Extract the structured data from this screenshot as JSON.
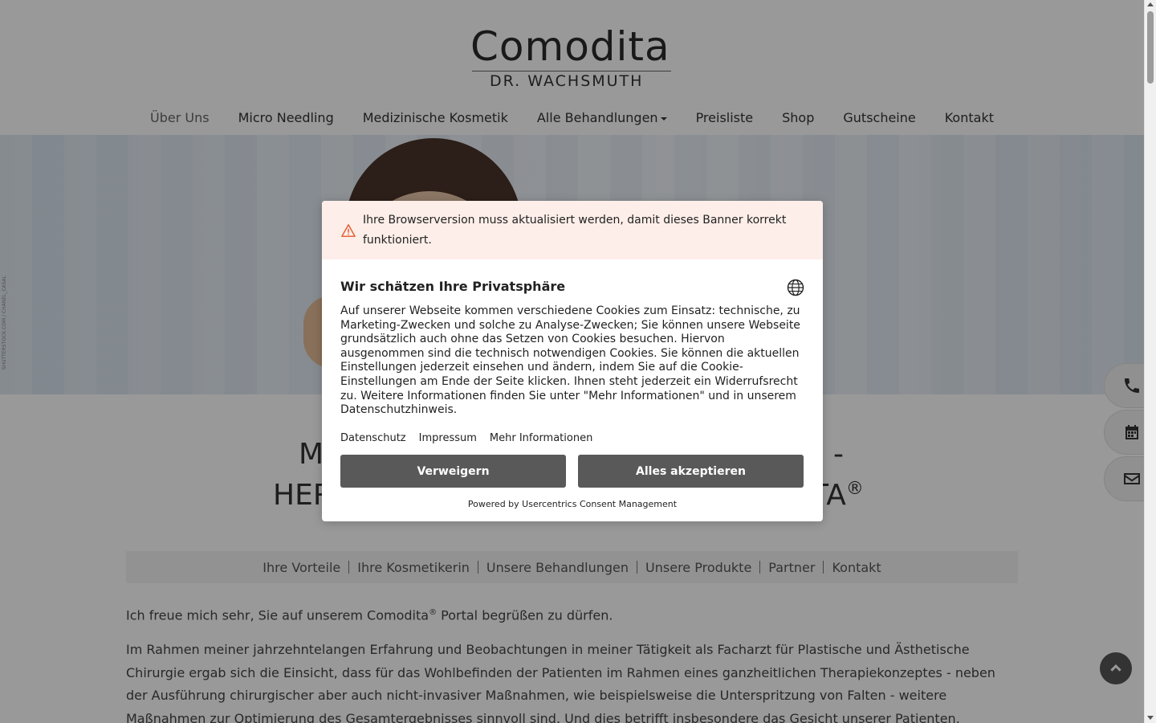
{
  "brand": {
    "logo_name": "Comodita",
    "logo_subtitle": "DR. WACHSMUTH"
  },
  "nav": {
    "items": [
      {
        "label": "Über Uns",
        "active": true
      },
      {
        "label": "Micro Needling"
      },
      {
        "label": "Medizinische Kosmetik"
      },
      {
        "label": "Alle Behandlungen",
        "dropdown": true
      },
      {
        "label": "Preisliste"
      },
      {
        "label": "Shop"
      },
      {
        "label": "Gutscheine"
      },
      {
        "label": "Kontakt"
      }
    ]
  },
  "hero": {
    "credit": "SHUTTERSTOCK.COM / CHANEL_CASAL"
  },
  "heading": {
    "line1_start": "M",
    "line1_end": "-",
    "line2_start": "HER",
    "line2_end": "TA",
    "registered": "®"
  },
  "subnav": {
    "items": [
      "Ihre Vorteile",
      "Ihre Kosmetikerin",
      "Unsere Behandlungen",
      "Unsere Produkte",
      "Partner",
      "Kontakt"
    ]
  },
  "content": {
    "intro_before": "Ich freue mich sehr, Sie auf unserem Comodita",
    "intro_reg": "®",
    "intro_after": " Portal begrüßen zu dürfen.",
    "paragraph": "Im Rahmen meiner jahrzehntelangen Erfahrung und Beobachtungen in meiner Tätigkeit als Facharzt für Plastische und Ästhetische Chirurgie ergab sich die Einsicht, dass für das Wohlbefinden der Patienten im Rahmen eines ganzheitlichen Therapiekonzeptes  - neben der Ausführung chirurgischer aber auch nicht-invasiver Maßnahmen, wie beispielsweise die Unterspritzung von Falten - weitere Maßnahmen zur Optimierung des Gesamtergebnisses sinnvoll sind. Und dies betrifft insbesondere das Gesicht unserer Patienten."
  },
  "side_tabs": {
    "icons": [
      "phone-icon",
      "calendar-icon",
      "envelope-icon"
    ]
  },
  "consent": {
    "warning": "Ihre Browserversion muss aktualisiert werden, damit dieses Banner korrekt funktioniert.",
    "title": "Wir schätzen Ihre Privatsphäre",
    "body": "Auf unserer Webseite kommen verschiedene Cookies zum Einsatz: technische, zu Marketing-Zwecken und solche zu Analyse-Zwecken; Sie können unsere Webseite grundsätzlich auch ohne das Setzen von Cookies besuchen. Hiervon ausgenommen sind die technisch notwendigen Cookies. Sie können die aktuellen Einstellungen jederzeit einsehen und ändern, indem Sie auf die Cookie-Einstellungen am Ende der Seite klicken. Ihnen steht jederzeit ein Widerrufsrecht zu. Weitere Informationen finden Sie unter \"Mehr Informationen\" und in unserem Datenschutzhinweis.",
    "links": [
      "Datenschutz",
      "Impressum",
      "Mehr Informationen"
    ],
    "deny_label": "Verweigern",
    "accept_label": "Alles akzeptieren",
    "powered_by": "Powered by Usercentrics Consent Management",
    "colors": {
      "button": "#595959",
      "warning_bg": "#fdeee9",
      "warning_icon": "#e2572b"
    }
  }
}
